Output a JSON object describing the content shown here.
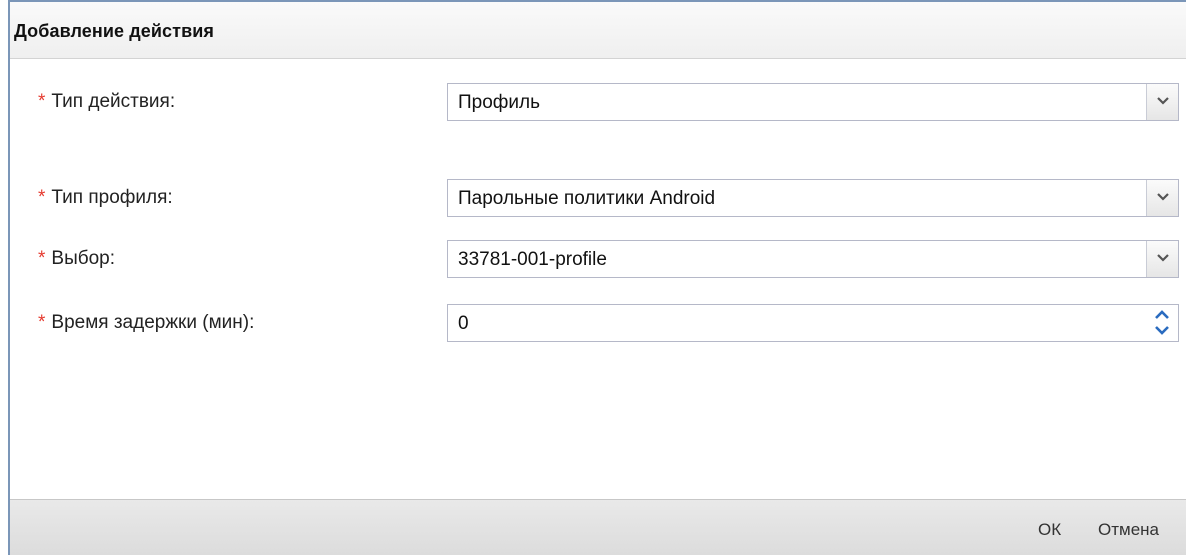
{
  "dialog": {
    "title": "Добавление действия"
  },
  "form": {
    "required_mark": "*",
    "action_type": {
      "label": "Тип действия:",
      "value": "Профиль"
    },
    "profile_type": {
      "label": "Тип профиля:",
      "value": "Парольные политики Android"
    },
    "selection": {
      "label": "Выбор:",
      "value": "33781-001-profile"
    },
    "delay": {
      "label": "Время задержки (мин):",
      "value": "0"
    }
  },
  "footer": {
    "ok_label": "ОК",
    "cancel_label": "Отмена"
  },
  "colors": {
    "required": "#e53a2f",
    "window_border": "#7b96b8",
    "spinner_arrow": "#2a6bbf"
  },
  "icons": {
    "dropdown": "chevron-down-icon",
    "spin_up": "arrow-up-icon",
    "spin_down": "arrow-down-icon"
  }
}
